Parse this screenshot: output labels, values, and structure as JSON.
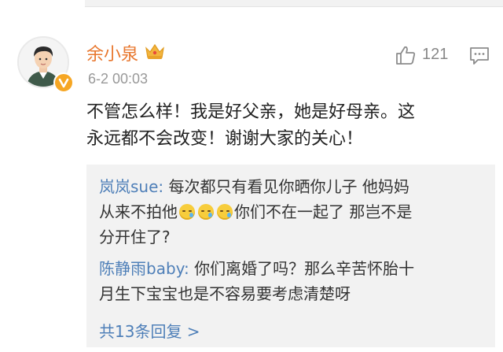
{
  "comment": {
    "username": "余小泉",
    "timestamp": "6-2 00:03",
    "like_count": "121",
    "text_line1": "不管怎么样！我是好父亲，她是好母亲。这",
    "text_line2": "永远都不会改变！谢谢大家的关心！"
  },
  "replies": [
    {
      "name": "岚岚sue:",
      "text_a": " 每次都只有看见你晒你儿子 他妈妈",
      "text_b": "从来不拍他",
      "text_c": "你们不在一起了 那岂不是",
      "text_d": "分开住了?"
    },
    {
      "name": "陈静雨baby:",
      "text_a": " 你们离婚了吗？那么辛苦怀胎十",
      "text_b": "月生下宝宝也是不容易要考虑清楚呀"
    }
  ],
  "more_replies": "共13条回复 >",
  "icons": {
    "crown": "crown-icon",
    "verified": "verified-v-icon",
    "like": "thumbs-up-icon",
    "reply": "comment-icon",
    "emoji": "crying-emoji-icon"
  },
  "colors": {
    "username": "#e8772e",
    "reply_name": "#4e7fb8",
    "reply_bg": "#f2f2f2",
    "verified_badge": "#f6a623"
  }
}
